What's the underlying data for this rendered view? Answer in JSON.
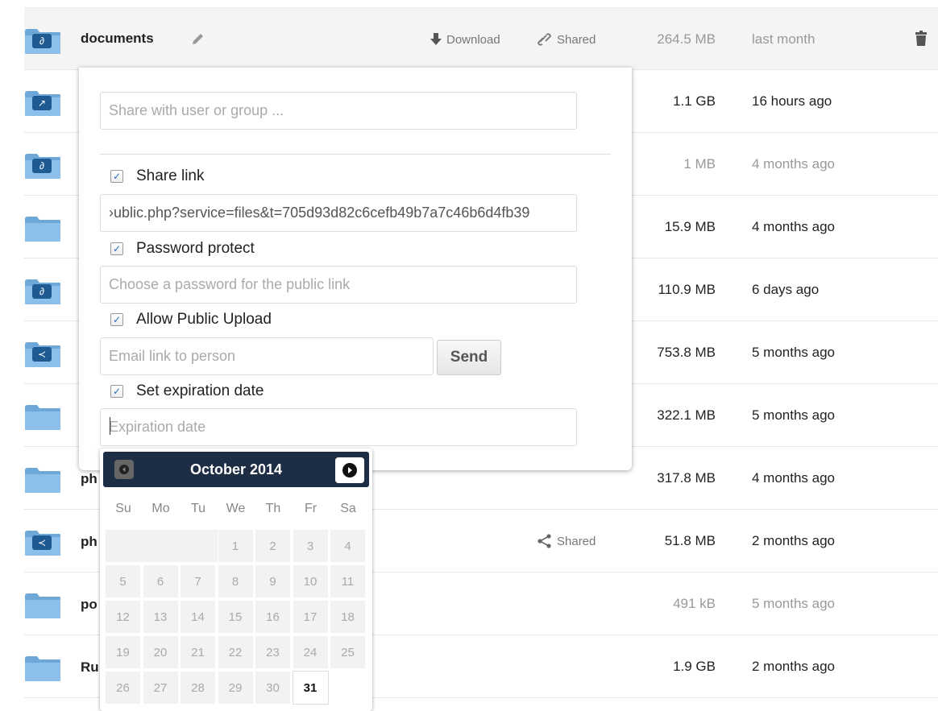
{
  "files": [
    {
      "name": "documents",
      "icon": "link-icon",
      "download_label": "Download",
      "shared_label": "Shared",
      "size": "264.5 MB",
      "date": "last month",
      "light": true
    },
    {
      "name": "",
      "icon": "external-share-icon",
      "size": "1.1 GB",
      "date": "16 hours ago",
      "light": false
    },
    {
      "name": "",
      "icon": "link-icon",
      "size": "1 MB",
      "date": "4 months ago",
      "light": true
    },
    {
      "name": "",
      "icon": "folder-icon",
      "size": "15.9 MB",
      "date": "4 months ago",
      "light": false
    },
    {
      "name": "",
      "icon": "link-icon",
      "size": "110.9 MB",
      "date": "6 days ago",
      "light": false
    },
    {
      "name": "",
      "icon": "share-icon",
      "size": "753.8 MB",
      "date": "5 months ago",
      "light": false
    },
    {
      "name": "",
      "icon": "folder-icon",
      "size": "322.1 MB",
      "date": "5 months ago",
      "light": false
    },
    {
      "name": "ph",
      "icon": "folder-icon",
      "size": "317.8 MB",
      "date": "4 months ago",
      "light": false
    },
    {
      "name": "ph",
      "icon": "share-icon",
      "shared_label": "Shared",
      "size": "51.8 MB",
      "date": "2 months ago",
      "light": false
    },
    {
      "name": "po",
      "icon": "folder-icon",
      "size": "491 kB",
      "date": "5 months ago",
      "light": true
    },
    {
      "name": "Ru",
      "icon": "folder-icon",
      "size": "1.9 GB",
      "date": "2 months ago",
      "light": false
    }
  ],
  "share": {
    "user_placeholder": "Share with user or group ...",
    "share_link_label": "Share link",
    "link_value": "›ublic.php?service=files&t=705d93d82c6cefb49b7a7c46b6d4fb39",
    "password_label": "Password protect",
    "password_placeholder": "Choose a password for the public link",
    "upload_label": "Allow Public Upload",
    "email_placeholder": "Email link to person",
    "send_label": "Send",
    "expiration_label": "Set expiration date",
    "expiration_placeholder": "Expiration date"
  },
  "datepicker": {
    "title": "October 2014",
    "weekdays": [
      "Su",
      "Mo",
      "Tu",
      "We",
      "Th",
      "Fr",
      "Sa"
    ],
    "weeks": [
      [
        "",
        "",
        "",
        "1",
        "2",
        "3",
        "4"
      ],
      [
        "5",
        "6",
        "7",
        "8",
        "9",
        "10",
        "11"
      ],
      [
        "12",
        "13",
        "14",
        "15",
        "16",
        "17",
        "18"
      ],
      [
        "19",
        "20",
        "21",
        "22",
        "23",
        "24",
        "25"
      ],
      [
        "26",
        "27",
        "28",
        "29",
        "30",
        "31",
        ""
      ]
    ],
    "today": "31"
  },
  "colors": {
    "badge": "#1f5b93",
    "header": "#1d2d44"
  }
}
